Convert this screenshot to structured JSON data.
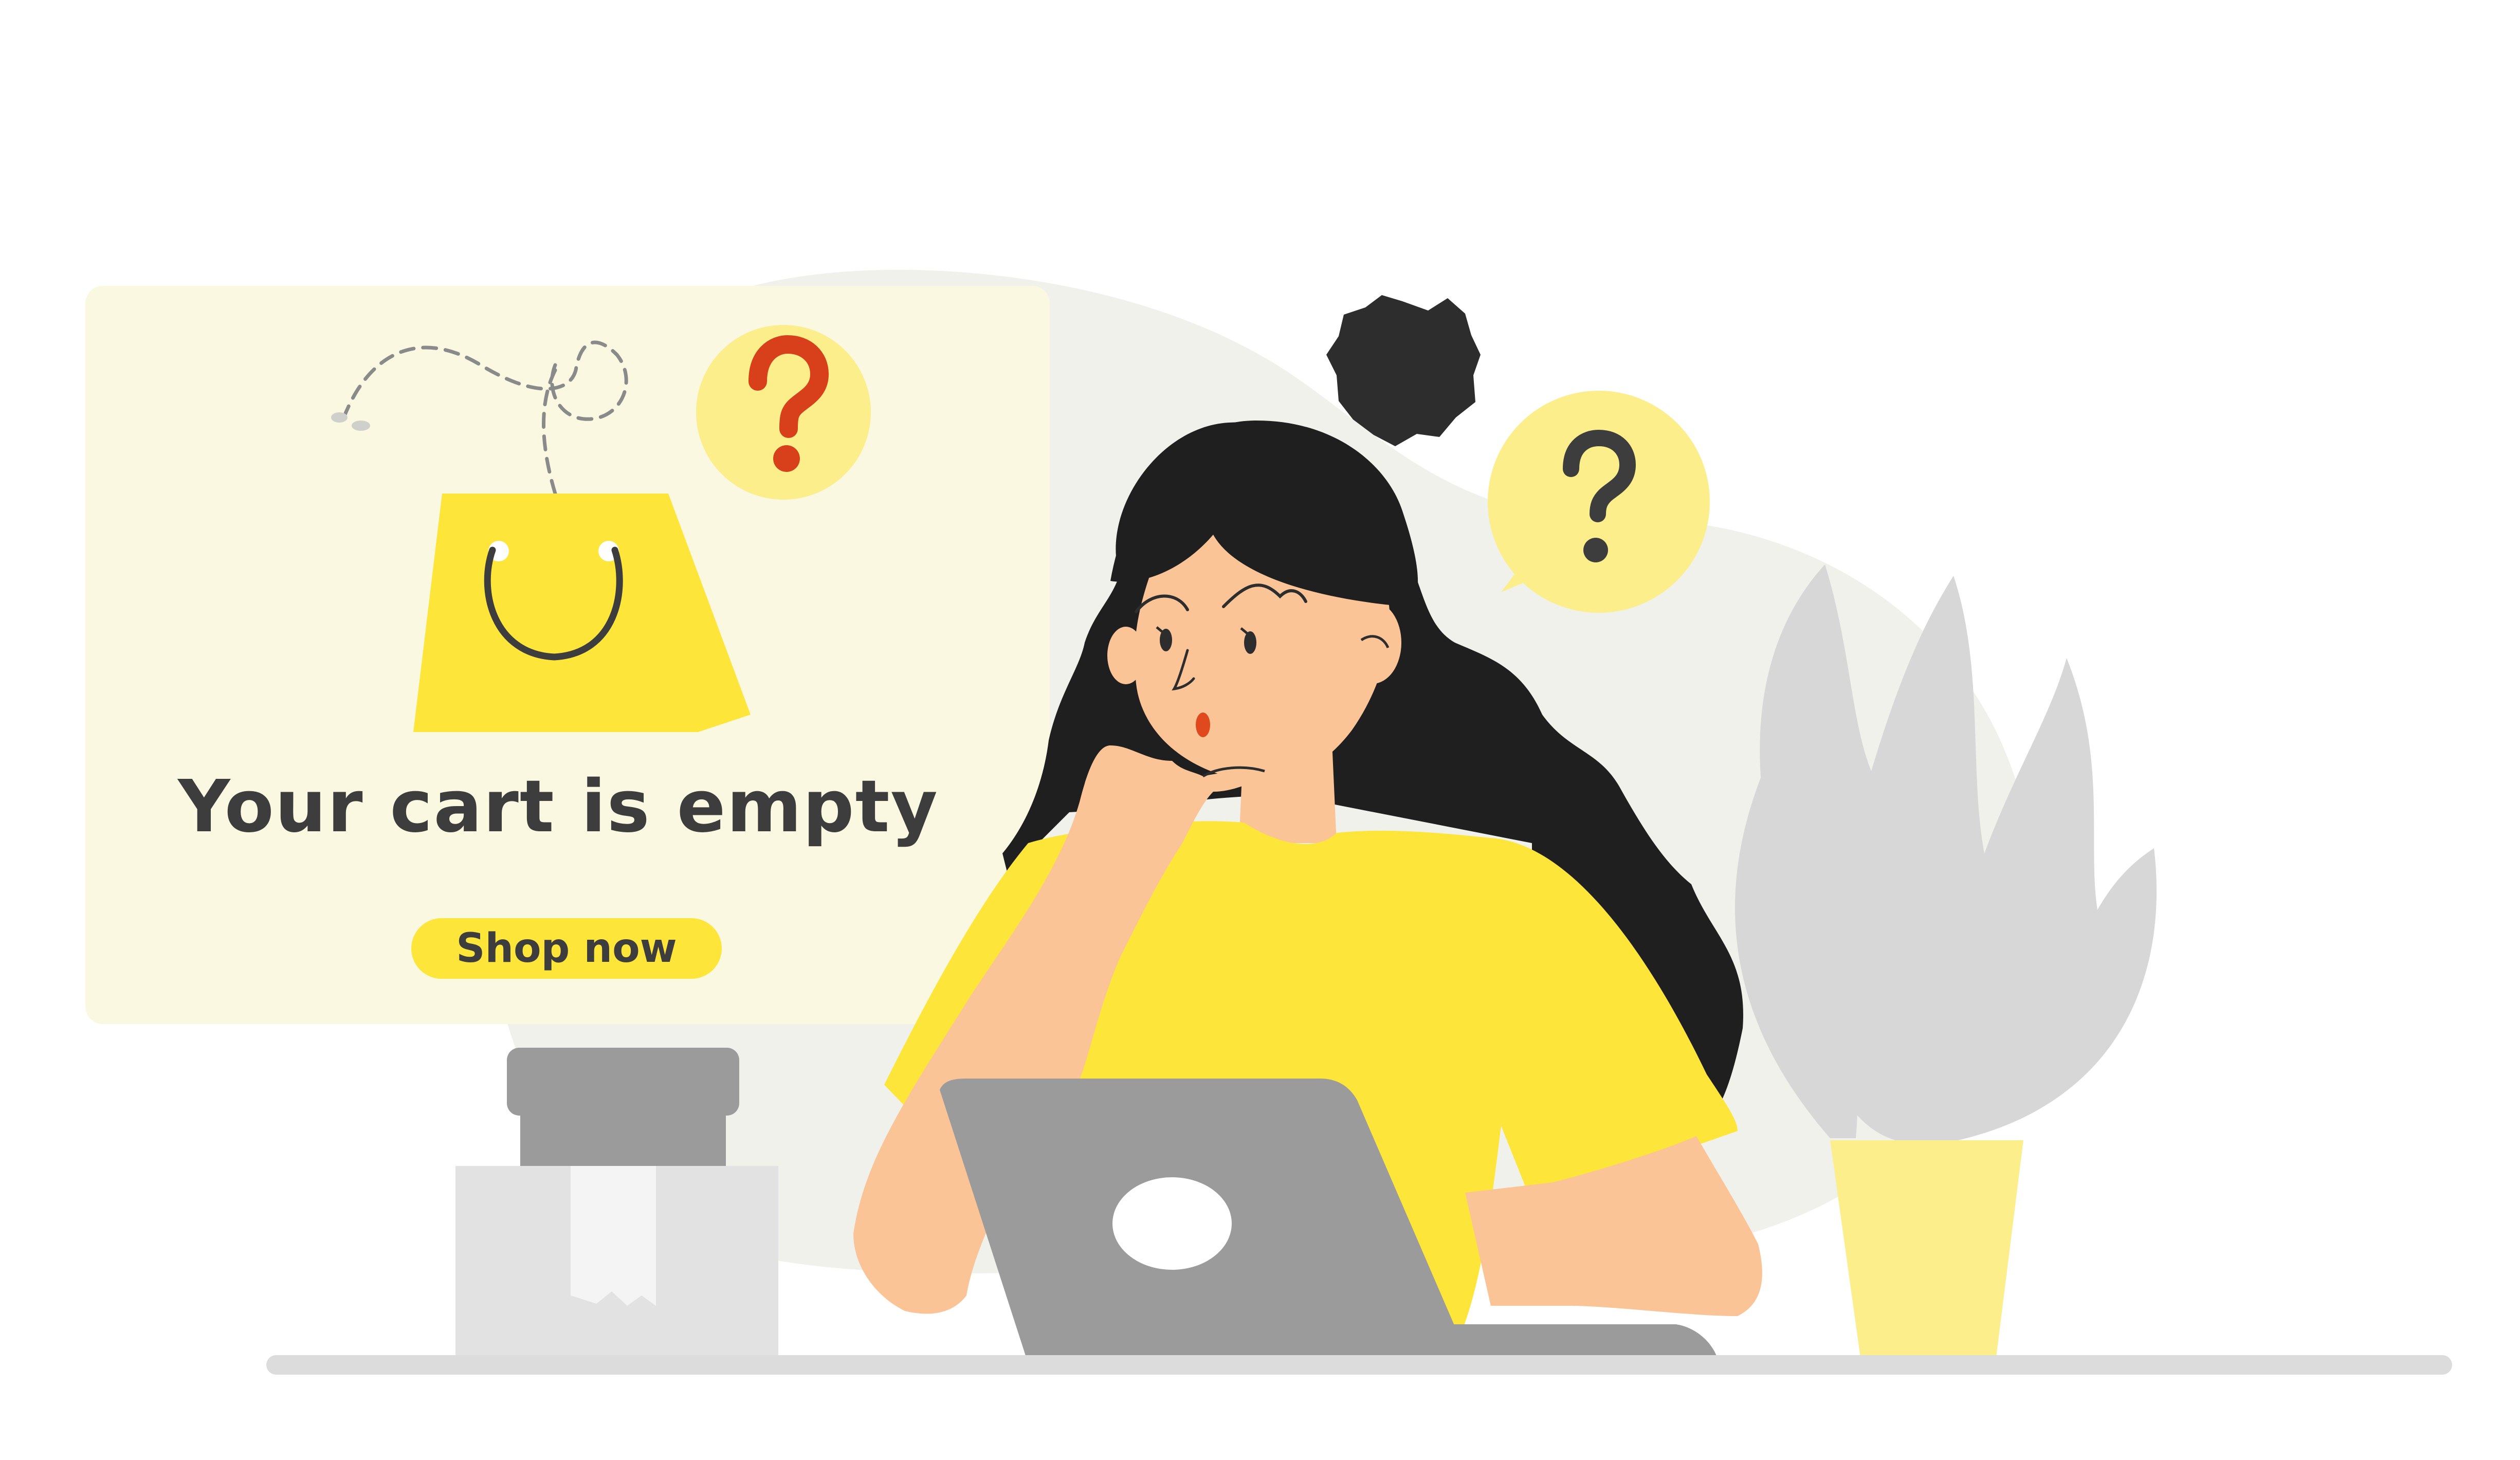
{
  "empty_cart": {
    "title": "Your cart is empty",
    "cta_label": "Shop now"
  },
  "icons": {
    "bag": "shopping-bag-icon",
    "cart_question": "question-mark-icon",
    "thought_question": "question-mark-icon",
    "frustration": "frustration-burst-icon"
  },
  "colors": {
    "accent_yellow": "#fde53a",
    "card_bg": "#fbf8e2",
    "question_red": "#d8401b",
    "text_dark": "#3d3d3d",
    "hair": "#1f1f1f",
    "skin": "#fac496",
    "laptop_gray": "#9b9b9b",
    "plant_gray": "#d7d7d7",
    "pot_yellow": "#fbee8b",
    "blob_gray": "#f1f1ec"
  }
}
